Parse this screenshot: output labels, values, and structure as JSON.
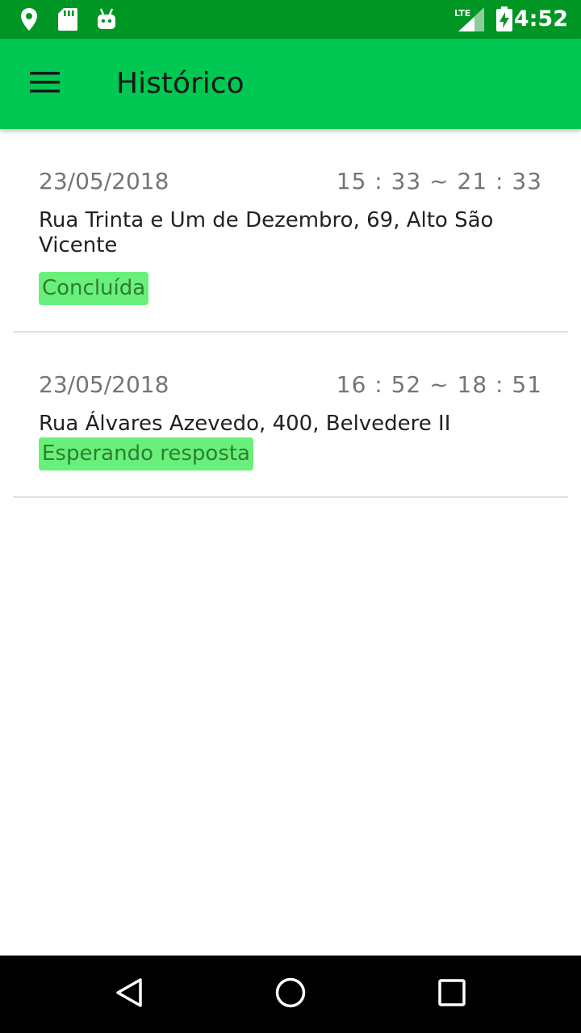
{
  "status_bar": {
    "time": "4:52",
    "network_label": "LTE",
    "colors": {
      "background": "#009624"
    },
    "icons": [
      "location-pin-icon",
      "sd-card-icon",
      "android-debug-icon",
      "lte-signal-icon",
      "battery-charging-icon"
    ]
  },
  "app_bar": {
    "title": "Histórico",
    "menu_icon": "hamburger-menu-icon",
    "colors": {
      "background": "#00c853"
    }
  },
  "history": [
    {
      "date": "23/05/2018",
      "time_range": "15 : 33  ~  21 : 33",
      "address": "Rua Trinta e Um de Dezembro, 69, Alto São Vicente",
      "status": "Concluída"
    },
    {
      "date": "23/05/2018",
      "time_range": "16 : 52  ~  18 : 51",
      "address": "Rua Álvares Azevedo, 400, Belvedere II",
      "status": "Esperando resposta"
    }
  ],
  "status_badge_colors": {
    "background": "#69f07a",
    "text": "#2e7d32"
  },
  "nav_bar": {
    "icons": [
      "back-triangle-icon",
      "home-circle-icon",
      "recents-square-icon"
    ]
  }
}
